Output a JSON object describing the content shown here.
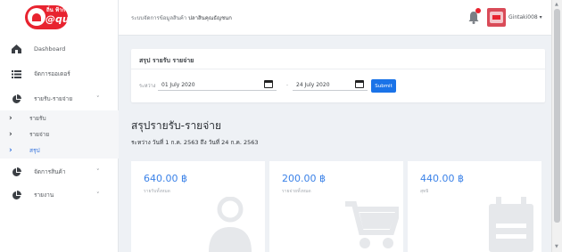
{
  "logo": {
    "small_text": "ถิ่น ฟ้าก",
    "brand_text": "@qua"
  },
  "topbar": {
    "system_title": "ระบบจัดการข้อมูลสินค้า",
    "system_subtitle": "ปลาสินคุณธัญชนก",
    "username": "Gintaki008 ▾"
  },
  "sidebar": {
    "items": [
      {
        "label": "Dashboard",
        "icon": "dashboard-icon"
      },
      {
        "label": "จัดการออเดอร์",
        "icon": "list-icon"
      },
      {
        "label": "รายรับ-รายจ่าย",
        "icon": "pie-chart-icon",
        "caret": "˅"
      },
      {
        "label": "จัดการสินค้า",
        "icon": "pie-chart-icon",
        "caret": "˅"
      },
      {
        "label": "รายงาน",
        "icon": "pie-chart-icon",
        "caret": "˅"
      }
    ],
    "sub_items": [
      {
        "label": "รายรับ",
        "active": false
      },
      {
        "label": "รายจ่าย",
        "active": false
      },
      {
        "label": "สรุป",
        "active": true
      }
    ]
  },
  "filter": {
    "heading": "สรุป รายรับ รายจ่าย",
    "range_label": "ระหว่าง",
    "start_date": "01 July 2020",
    "separator": "-",
    "end_date": "24 July 2020",
    "submit_label": "Submit"
  },
  "summary": {
    "title": "สรุปรายรับ-รายจ่าย",
    "range_text": "ระหว่าง วันที่ 1 ก.ค. 2563 ถึง วันที่ 24 ก.ค. 2563",
    "cards": [
      {
        "amount": "640.00 ฿",
        "label": "รายรับทั้งหมด",
        "icon": "user-icon"
      },
      {
        "amount": "200.00 ฿",
        "label": "รายจ่ายทั้งหมด",
        "icon": "cart-icon"
      },
      {
        "amount": "440.00 ฿",
        "label": "สุทธิ",
        "icon": "calendar-icon"
      }
    ]
  },
  "colors": {
    "accent": "#1a73e8",
    "amount": "#3b82e8",
    "brand_red": "#e8232f",
    "background": "#eef1f5"
  }
}
